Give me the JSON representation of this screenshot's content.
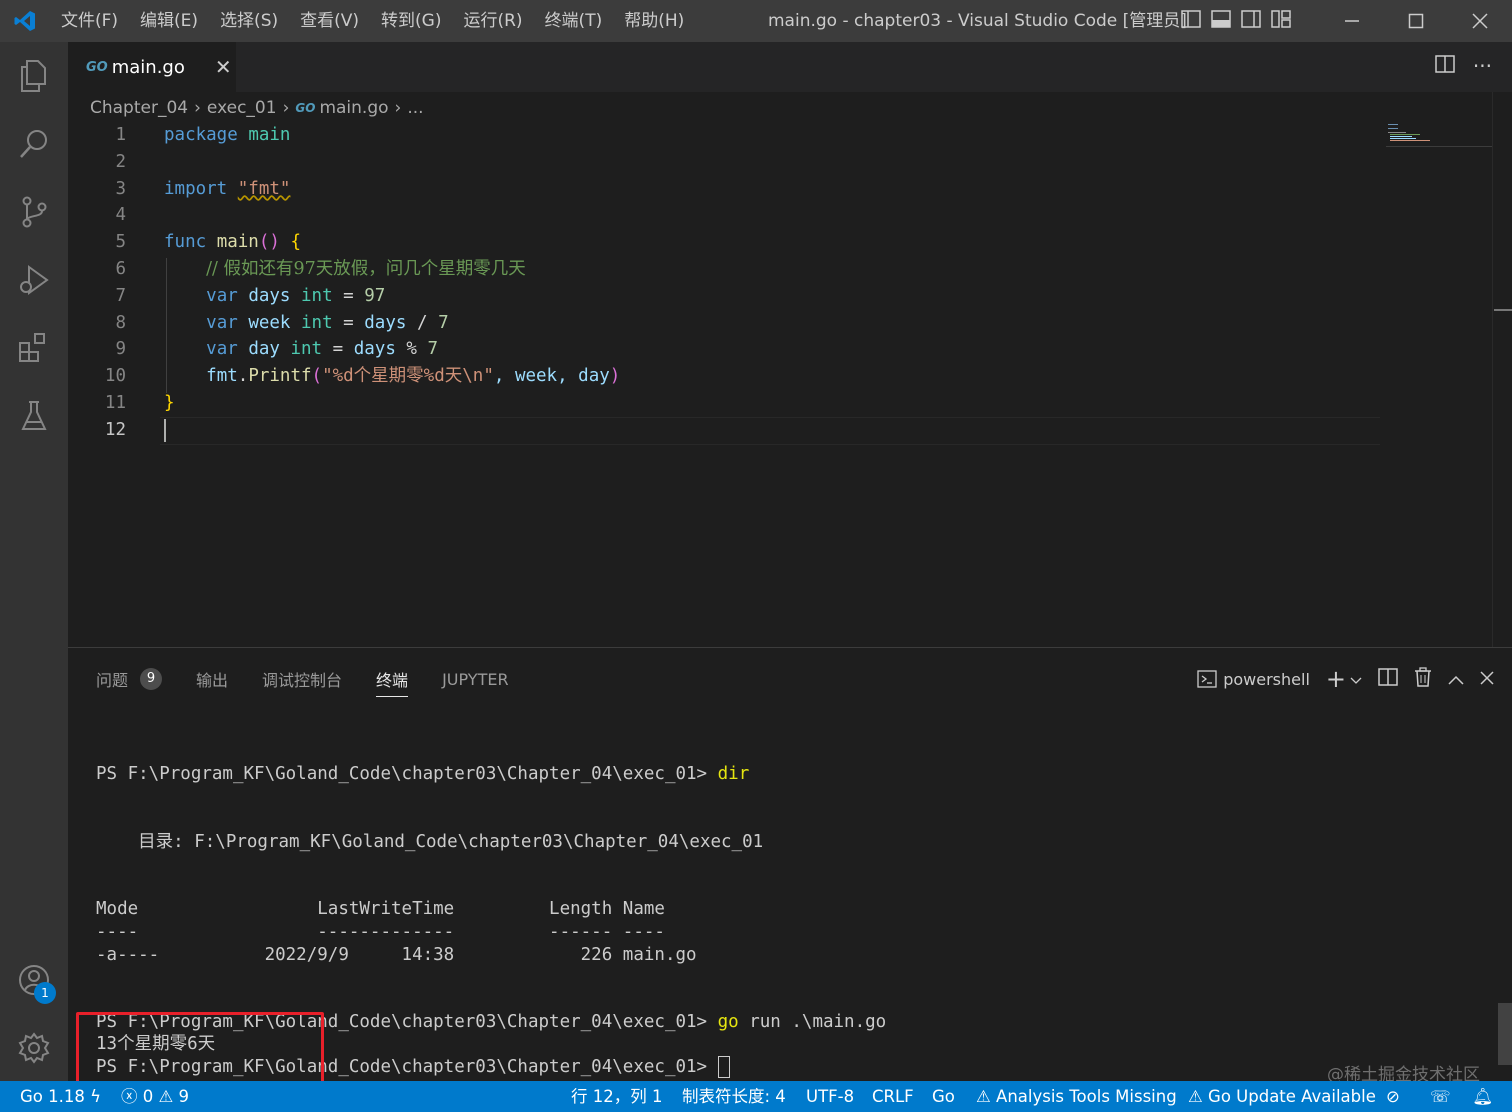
{
  "titlebar": {
    "menu": [
      "文件(F)",
      "编辑(E)",
      "选择(S)",
      "查看(V)",
      "转到(G)",
      "运行(R)",
      "终端(T)",
      "帮助(H)"
    ],
    "window_title": "main.go - chapter03 - Visual Studio Code [管理员]"
  },
  "tab": {
    "icon": "GO",
    "name": "main.go"
  },
  "breadcrumb": {
    "items": [
      "Chapter_04",
      "exec_01",
      "main.go",
      "..."
    ],
    "go_icon": "GO"
  },
  "editor": {
    "line_numbers": [
      "1",
      "2",
      "3",
      "4",
      "5",
      "6",
      "7",
      "8",
      "9",
      "10",
      "11",
      "12"
    ],
    "code": {
      "l1_kw": "package",
      "l1_name": "main",
      "l3_kw": "import",
      "l3_str": "\"fmt\"",
      "l5_kw": "func",
      "l5_fn": "main",
      "l5_paren": "()",
      "l5_brace": "{",
      "l6_comment": "// 假如还有97天放假，问几个星期零几天",
      "l7_kw": "var",
      "l7_var": "days",
      "l7_type": "int",
      "l7_eq": "=",
      "l7_num": "97",
      "l8_kw": "var",
      "l8_var": "week",
      "l8_type": "int",
      "l8_eq": "=",
      "l8_ref": "days",
      "l8_op": "/",
      "l8_num": "7",
      "l9_kw": "var",
      "l9_var": "day",
      "l9_type": "int",
      "l9_eq": "=",
      "l9_ref": "days",
      "l9_op": "%",
      "l9_num": "7",
      "l10_pkg": "fmt",
      "l10_dot": ".",
      "l10_fn": "Printf",
      "l10_open": "(",
      "l10_str": "\"%d个星期零%d天\\n\"",
      "l10_args": ", week, day",
      "l10_close": ")",
      "l11_brace": "}"
    },
    "current_line": "12"
  },
  "panel": {
    "tabs": [
      "问题",
      "输出",
      "调试控制台",
      "终端",
      "JUPYTER"
    ],
    "problems_count": "9",
    "active_tab": "终端",
    "shell": "powershell",
    "terminal": {
      "prompt1": "PS F:\\Program_KF\\Goland_Code\\chapter03\\Chapter_04\\exec_01> ",
      "cmd1": "dir",
      "dir_header": "    目录: F:\\Program_KF\\Goland_Code\\chapter03\\Chapter_04\\exec_01",
      "col_headers": "Mode                 LastWriteTime         Length Name",
      "col_dashes": "----                 -------------         ------ ----",
      "row1": "-a----          2022/9/9     14:38            226 main.go",
      "prompt2": "PS F:\\Program_KF\\Goland_Code\\chapter03\\Chapter_04\\exec_01> ",
      "cmd2": "go",
      "cmd2_rest": " run .\\main.go",
      "output": "13个星期零6天",
      "prompt3": "PS F:\\Program_KF\\Goland_Code\\chapter03\\Chapter_04\\exec_01> "
    },
    "watermark": "@稀土掘金技术社区"
  },
  "activity": {
    "accounts_badge": "1"
  },
  "statusbar": {
    "go_version": "Go 1.18",
    "errors": "0",
    "warnings": "9",
    "position": "行 12，列 1",
    "tab_size": "制表符长度: 4",
    "encoding": "UTF-8",
    "eol": "CRLF",
    "language": "Go",
    "analysis": "Analysis Tools Missing",
    "update": "Go Update Available"
  },
  "colors": {
    "accent": "#007acc",
    "highlight_box": "#e8202a"
  }
}
